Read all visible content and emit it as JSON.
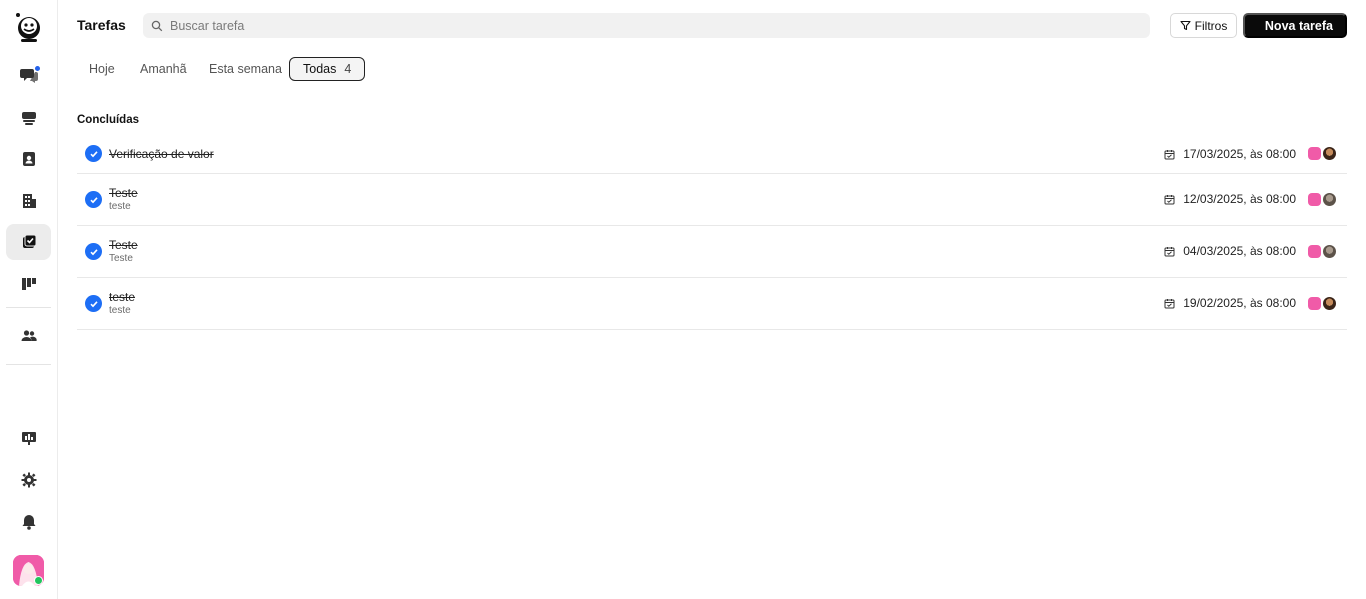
{
  "colors": {
    "accent": "#1d6ef5",
    "primary_button": "#0a0a0a",
    "notification_dot": "#2563eb",
    "online_status": "#22c55e",
    "avatar_pink": "#f05ba8"
  },
  "sidebar": {
    "logo": "mascot-logo-icon",
    "items": [
      {
        "icon": "chat-icon",
        "badge": true,
        "active": false
      },
      {
        "icon": "inbox-icon",
        "active": false
      },
      {
        "icon": "contacts-icon",
        "active": false
      },
      {
        "icon": "building-icon",
        "active": false
      },
      {
        "icon": "tasks-icon",
        "active": true
      },
      {
        "icon": "kanban-icon",
        "active": false
      },
      {
        "icon": "team-icon",
        "active": false
      }
    ],
    "bottom_items": [
      {
        "icon": "presentation-icon"
      },
      {
        "icon": "gear-icon"
      },
      {
        "icon": "bell-icon"
      }
    ],
    "user_status": "online"
  },
  "header": {
    "title": "Tarefas",
    "search_placeholder": "Buscar tarefa",
    "filters_label": "Filtros",
    "new_task_label": "Nova tarefa"
  },
  "tabs": [
    {
      "label": "Hoje",
      "active": false
    },
    {
      "label": "Amanhã",
      "active": false
    },
    {
      "label": "Esta semana",
      "active": false
    },
    {
      "label": "Todas",
      "count": "4",
      "active": true
    }
  ],
  "section": {
    "title": "Concluídas"
  },
  "tasks": [
    {
      "title": "Verificação de valor",
      "description": "",
      "due": "17/03/2025, às 08:00",
      "assignees": [
        "pink",
        "dark"
      ],
      "completed": true
    },
    {
      "title": "Teste",
      "description": "teste",
      "due": "12/03/2025, às 08:00",
      "assignees": [
        "pink",
        "gray"
      ],
      "completed": true
    },
    {
      "title": "Teste",
      "description": "Teste",
      "due": "04/03/2025, às 08:00",
      "assignees": [
        "pink",
        "gray"
      ],
      "completed": true
    },
    {
      "title": "teste",
      "description": "teste",
      "due": "19/02/2025, às 08:00",
      "assignees": [
        "pink",
        "dark"
      ],
      "completed": true
    }
  ]
}
